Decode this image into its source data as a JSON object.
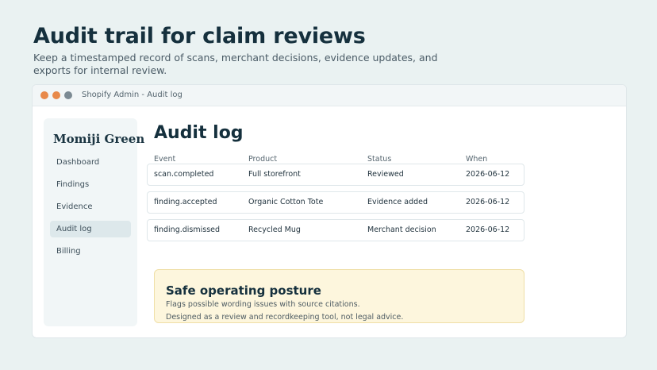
{
  "hero": {
    "title": "Audit trail for claim reviews",
    "subtitle": "Keep a timestamped record of scans, merchant decisions, evidence updates, and exports for internal review."
  },
  "window": {
    "title": "Shopify Admin - Audit log",
    "controls": [
      "close",
      "minimize",
      "maximize"
    ]
  },
  "sidebar": {
    "shop_name": "Momiji Green",
    "items": [
      {
        "label": "Dashboard",
        "active": false
      },
      {
        "label": "Findings",
        "active": false
      },
      {
        "label": "Evidence",
        "active": false
      },
      {
        "label": "Audit log",
        "active": true
      },
      {
        "label": "Billing",
        "active": false
      }
    ]
  },
  "main": {
    "title": "Audit log",
    "columns": [
      "Event",
      "Product",
      "Status",
      "When"
    ],
    "rows": [
      {
        "event": "scan.completed",
        "product": "Full storefront",
        "status": "Reviewed",
        "when": "2026-06-12"
      },
      {
        "event": "finding.accepted",
        "product": "Organic Cotton Tote",
        "status": "Evidence added",
        "when": "2026-06-12"
      },
      {
        "event": "finding.dismissed",
        "product": "Recycled Mug",
        "status": "Merchant decision",
        "when": "2026-06-12"
      }
    ]
  },
  "notice": {
    "title": "Safe operating posture",
    "line1": "Flags possible wording issues with source citations.",
    "line2": "Designed as a review and recordkeeping tool, not legal advice."
  },
  "colors": {
    "background": "#eaf2f2",
    "accent_orange": "#e8894a",
    "notice_bg": "#fdf6dd",
    "active_nav": "#dde8eb"
  }
}
